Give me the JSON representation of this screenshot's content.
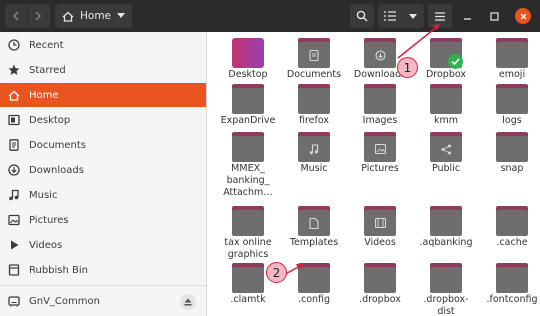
{
  "header": {
    "location": "Home",
    "icons": {
      "back": "chevron-left-icon",
      "forward": "chevron-right-icon",
      "home": "home-icon",
      "search": "search-icon",
      "view": "list-view-icon",
      "menu": "hamburger-menu-icon",
      "minimize": "minimize-icon",
      "maximize": "maximize-icon",
      "close": "close-icon"
    }
  },
  "sidebar": {
    "items": [
      {
        "label": "Recent",
        "icon": "clock-icon"
      },
      {
        "label": "Starred",
        "icon": "star-icon"
      },
      {
        "label": "Home",
        "icon": "home-icon",
        "active": true
      },
      {
        "label": "Desktop",
        "icon": "desktop-icon"
      },
      {
        "label": "Documents",
        "icon": "document-icon"
      },
      {
        "label": "Downloads",
        "icon": "download-icon"
      },
      {
        "label": "Music",
        "icon": "music-icon"
      },
      {
        "label": "Pictures",
        "icon": "picture-icon"
      },
      {
        "label": "Videos",
        "icon": "video-icon"
      },
      {
        "label": "Rubbish Bin",
        "icon": "trash-icon"
      }
    ],
    "drive": {
      "label": "GnV_Common",
      "icon": "drive-icon",
      "eject_icon": "eject-icon"
    }
  },
  "files": [
    {
      "name": "Desktop",
      "icon": "desktop-folder"
    },
    {
      "name": "Documents",
      "icon": "documents-folder"
    },
    {
      "name": "Downloads",
      "icon": "downloads-folder"
    },
    {
      "name": "Dropbox",
      "icon": "dropbox-folder",
      "synced": true
    },
    {
      "name": "emoji",
      "icon": "folder"
    },
    {
      "name": "ExpanDrive",
      "icon": "folder"
    },
    {
      "name": "firefox",
      "icon": "folder"
    },
    {
      "name": "Images",
      "icon": "folder"
    },
    {
      "name": "kmm",
      "icon": "folder"
    },
    {
      "name": "logs",
      "icon": "folder"
    },
    {
      "name": "MMEX_\nbanking_\nAttachm…",
      "icon": "folder"
    },
    {
      "name": "Music",
      "icon": "music-folder"
    },
    {
      "name": "Pictures",
      "icon": "pictures-folder"
    },
    {
      "name": "Public",
      "icon": "public-folder"
    },
    {
      "name": "snap",
      "icon": "folder"
    },
    {
      "name": "tax online\ngraphics",
      "icon": "folder"
    },
    {
      "name": "Templates",
      "icon": "templates-folder"
    },
    {
      "name": "Videos",
      "icon": "videos-folder"
    },
    {
      "name": ".aqbanking",
      "icon": "folder"
    },
    {
      "name": ".cache",
      "icon": "folder"
    },
    {
      "name": ".clamtk",
      "icon": "folder"
    },
    {
      "name": ".config",
      "icon": "folder"
    },
    {
      "name": ".dropbox",
      "icon": "folder"
    },
    {
      "name": ".dropbox-\ndist",
      "icon": "folder"
    },
    {
      "name": ".fontconfig",
      "icon": "folder"
    }
  ],
  "annotations": [
    {
      "label": "1"
    },
    {
      "label": "2"
    }
  ],
  "colors": {
    "accent": "#e95420",
    "folder_tab": "#8e3b5c",
    "folder_body": "#6e6e6e",
    "annotation": "#d0243a",
    "headerbar": "#2b2b2b"
  }
}
